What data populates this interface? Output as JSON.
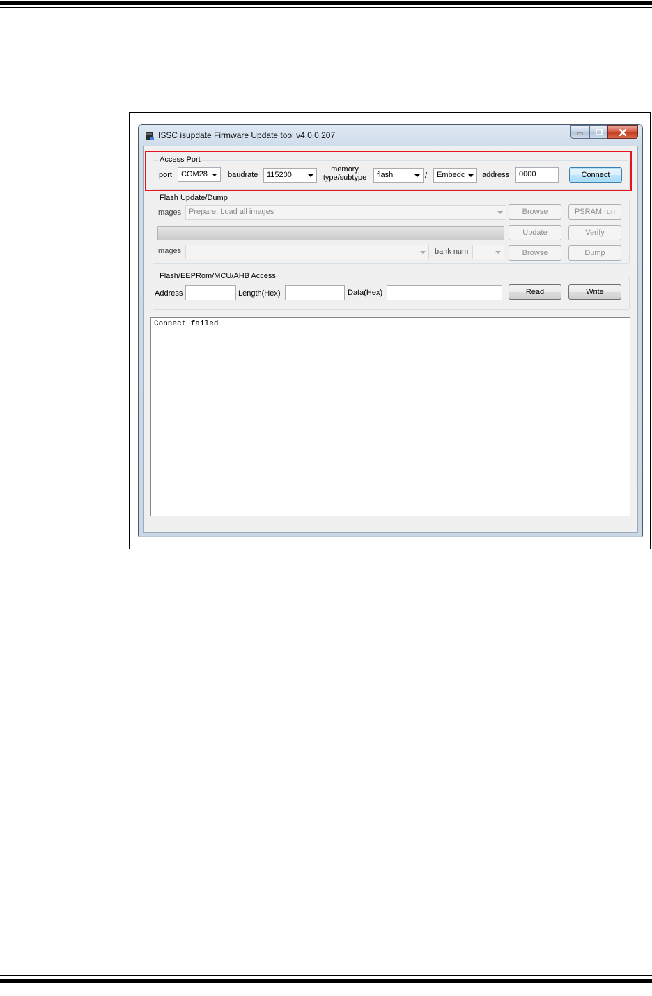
{
  "window": {
    "title": "ISSC isupdate Firmware Update tool  v4.0.0.207",
    "icon": "app-icon",
    "caption_buttons": [
      "minimize-icon",
      "maximize-icon",
      "close-icon"
    ]
  },
  "access_port": {
    "group_label": "Access Port",
    "port_label": "port",
    "port_value": "COM28",
    "baudrate_label": "baudrate",
    "baudrate_value": "115200",
    "memory_label_line1": "memory",
    "memory_label_line2": "type/subtype",
    "memory_type_value": "flash",
    "slash": "/",
    "memory_subtype_value": "Embedc",
    "address_label": "address",
    "address_value": "0000",
    "connect_label": "Connect"
  },
  "flash_update": {
    "group_label": "Flash Update/Dump",
    "images_label_1": "Images",
    "images_value_1": "Prepare: Load all images",
    "browse_label_1": "Browse",
    "psram_run_label": "PSRAM run",
    "update_label": "Update",
    "verify_label": "Verify",
    "images_label_2": "Images",
    "images_value_2": "",
    "bank_num_label": "bank num",
    "bank_num_value": "",
    "browse_label_2": "Browse",
    "dump_label": "Dump"
  },
  "access": {
    "group_label": "Flash/EEPRom/MCU/AHB Access",
    "address_label": "Address",
    "address_value": "",
    "length_label": "Length(Hex)",
    "length_value": "",
    "data_label": "Data(Hex)",
    "data_value": "",
    "read_label": "Read",
    "write_label": "Write"
  },
  "log": {
    "lines": [
      "Connect failed"
    ]
  },
  "colors": {
    "highlight": "#e8141b",
    "connect_button": "#bee6fd",
    "close_button": "#c23a1f"
  }
}
